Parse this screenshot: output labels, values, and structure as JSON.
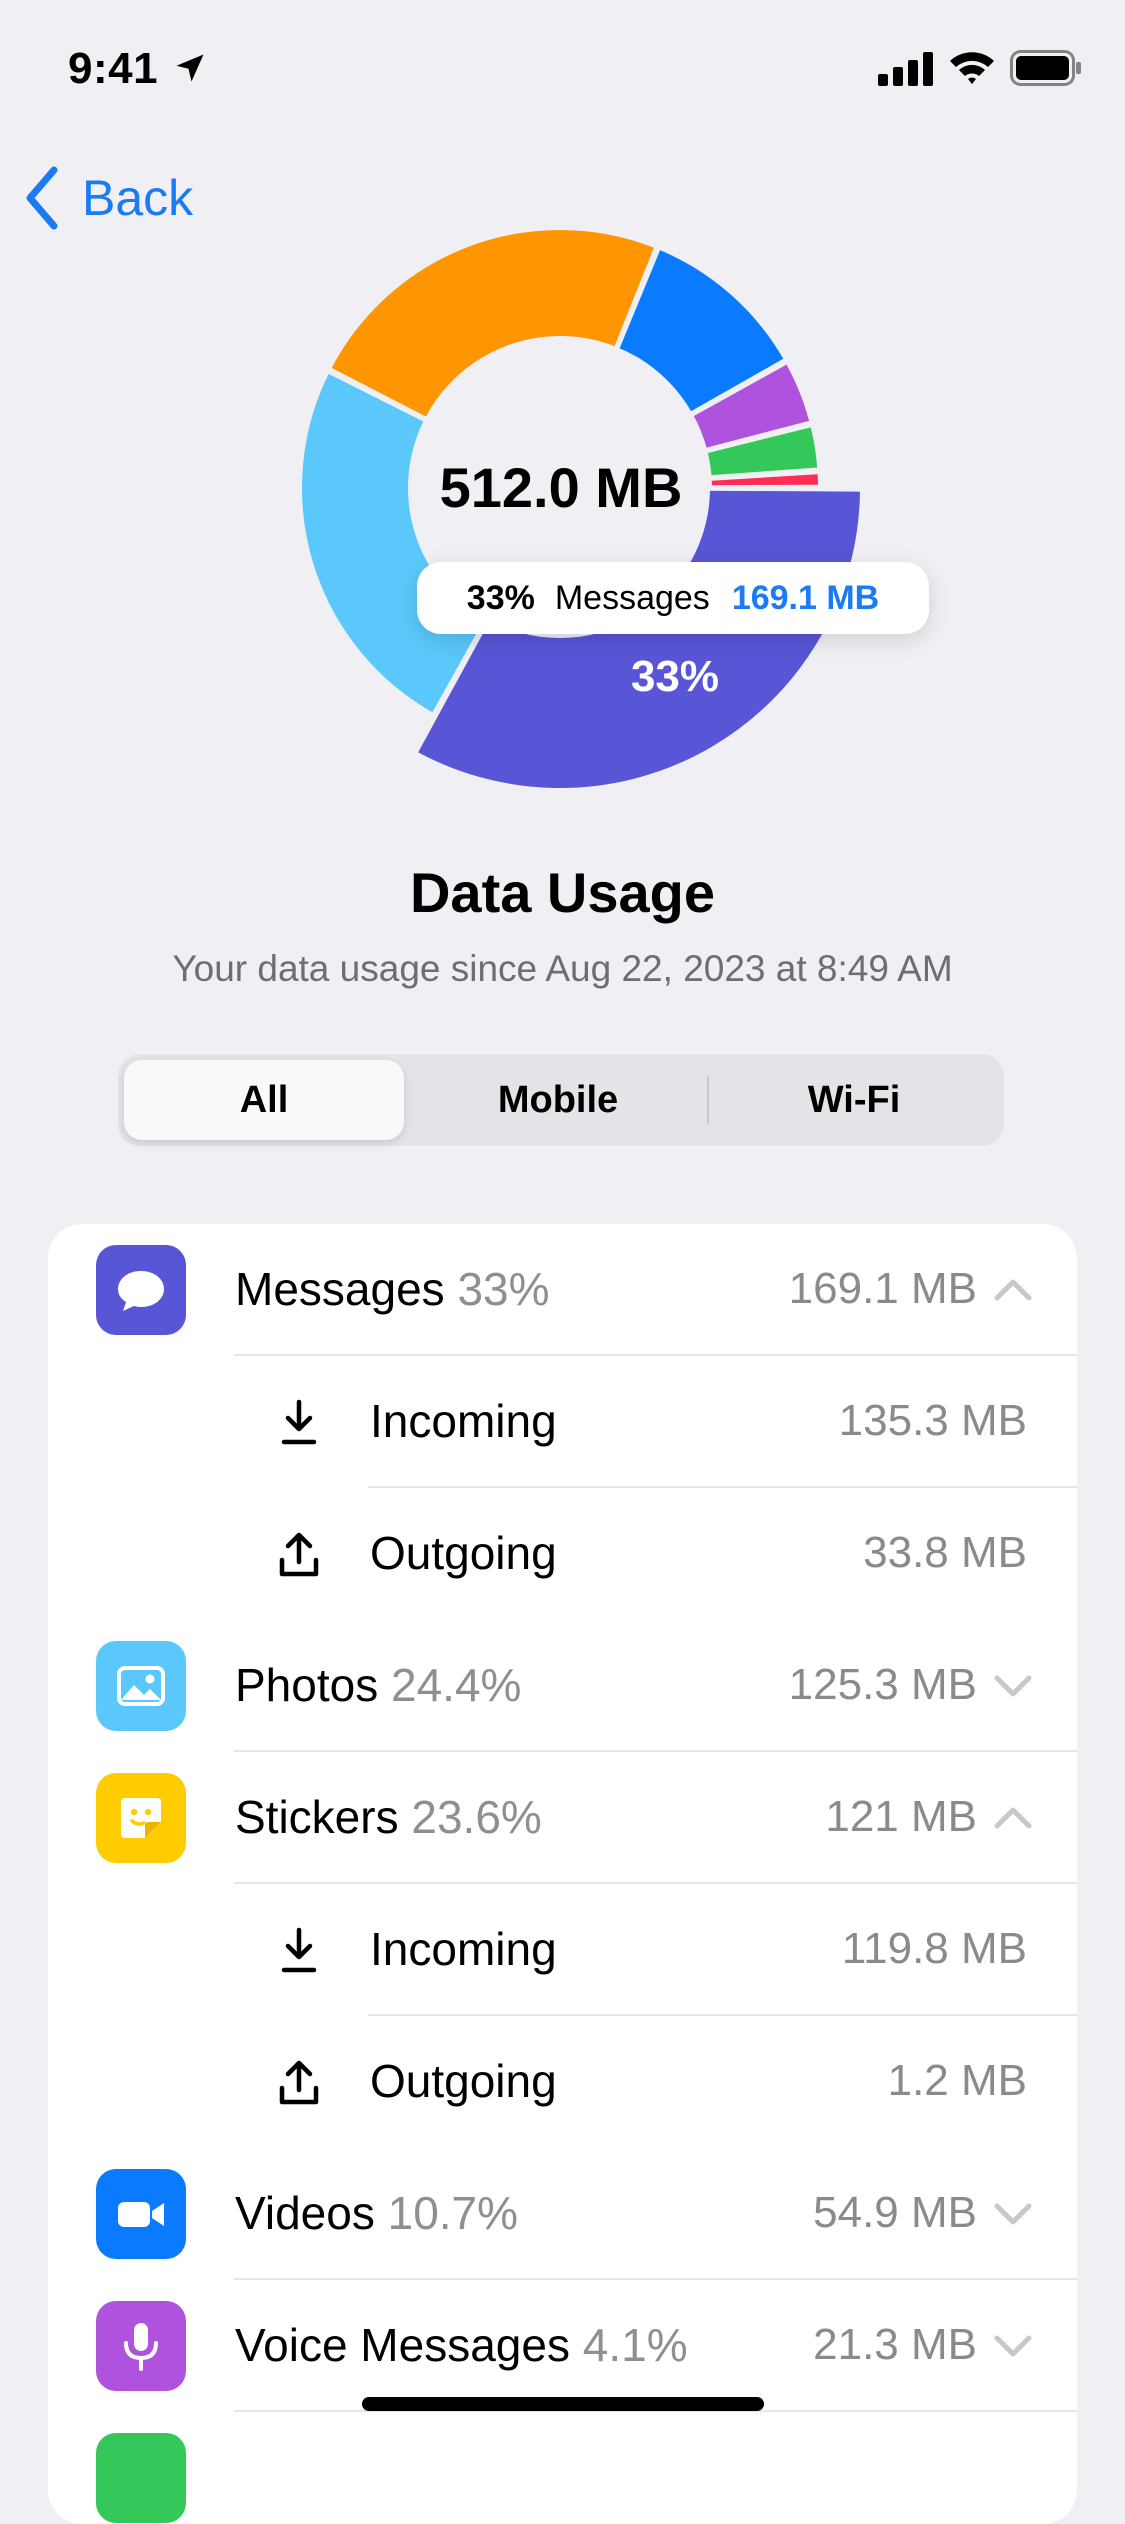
{
  "status_bar": {
    "time": "9:41",
    "icons": [
      "location-arrow-icon",
      "cellular-signal-icon",
      "wifi-icon",
      "battery-icon"
    ]
  },
  "nav": {
    "back_label": "Back",
    "accent": "#1a7bf2"
  },
  "chart": {
    "total": "512.0 MB",
    "highlight_percent": "33%",
    "tooltip": {
      "percent": "33%",
      "name": "Messages",
      "value": "169.1 MB"
    }
  },
  "chart_data": {
    "type": "pie",
    "title": "512.0 MB",
    "unit": "MB",
    "slices": [
      {
        "label": "Messages",
        "value": 169.1,
        "percent": 33,
        "color": "#5856d6",
        "highlighted": true
      },
      {
        "label": "Photos",
        "value": 125.3,
        "percent": 24.4,
        "color": "#5ac8fa"
      },
      {
        "label": "Stickers",
        "value": 121,
        "percent": 23.6,
        "color": "#ff9500"
      },
      {
        "label": "Videos",
        "value": 54.9,
        "percent": 10.7,
        "color": "#0a7aff"
      },
      {
        "label": "Voice Messages",
        "value": 21.3,
        "percent": 4.1,
        "color": "#af52de"
      },
      {
        "label": "",
        "value": 15.0,
        "percent": 2.9,
        "color": "#34c759"
      },
      {
        "label": "",
        "value": 5.4,
        "percent": 1.1,
        "color": "#ff2d55"
      }
    ]
  },
  "header": {
    "title": "Data Usage",
    "subtitle": "Your data usage since Aug 22, 2023 at 8:49 AM"
  },
  "segments": {
    "options": [
      "All",
      "Mobile",
      "Wi-Fi"
    ],
    "selected": "All"
  },
  "usage_list": [
    {
      "name": "Messages",
      "percent": "33%",
      "value": "169.1 MB",
      "expanded": true,
      "icon": "speech-bubble-icon",
      "color": "#5856d6",
      "details": [
        {
          "label": "Incoming",
          "value": "135.3 MB",
          "icon": "download-icon"
        },
        {
          "label": "Outgoing",
          "value": "33.8 MB",
          "icon": "upload-icon"
        }
      ]
    },
    {
      "name": "Photos",
      "percent": "24.4%",
      "value": "125.3 MB",
      "expanded": false,
      "icon": "photo-icon",
      "color": "#5ac8fa"
    },
    {
      "name": "Stickers",
      "percent": "23.6%",
      "value": "121 MB",
      "expanded": true,
      "icon": "sticker-icon",
      "color": "#ffcc00",
      "details": [
        {
          "label": "Incoming",
          "value": "119.8 MB",
          "icon": "download-icon"
        },
        {
          "label": "Outgoing",
          "value": "1.2 MB",
          "icon": "upload-icon"
        }
      ]
    },
    {
      "name": "Videos",
      "percent": "10.7%",
      "value": "54.9 MB",
      "expanded": false,
      "icon": "video-camera-icon",
      "color": "#0a7aff"
    },
    {
      "name": "Voice Messages",
      "percent": "4.1%",
      "value": "21.3 MB",
      "expanded": false,
      "icon": "microphone-icon",
      "color": "#af52de"
    }
  ]
}
